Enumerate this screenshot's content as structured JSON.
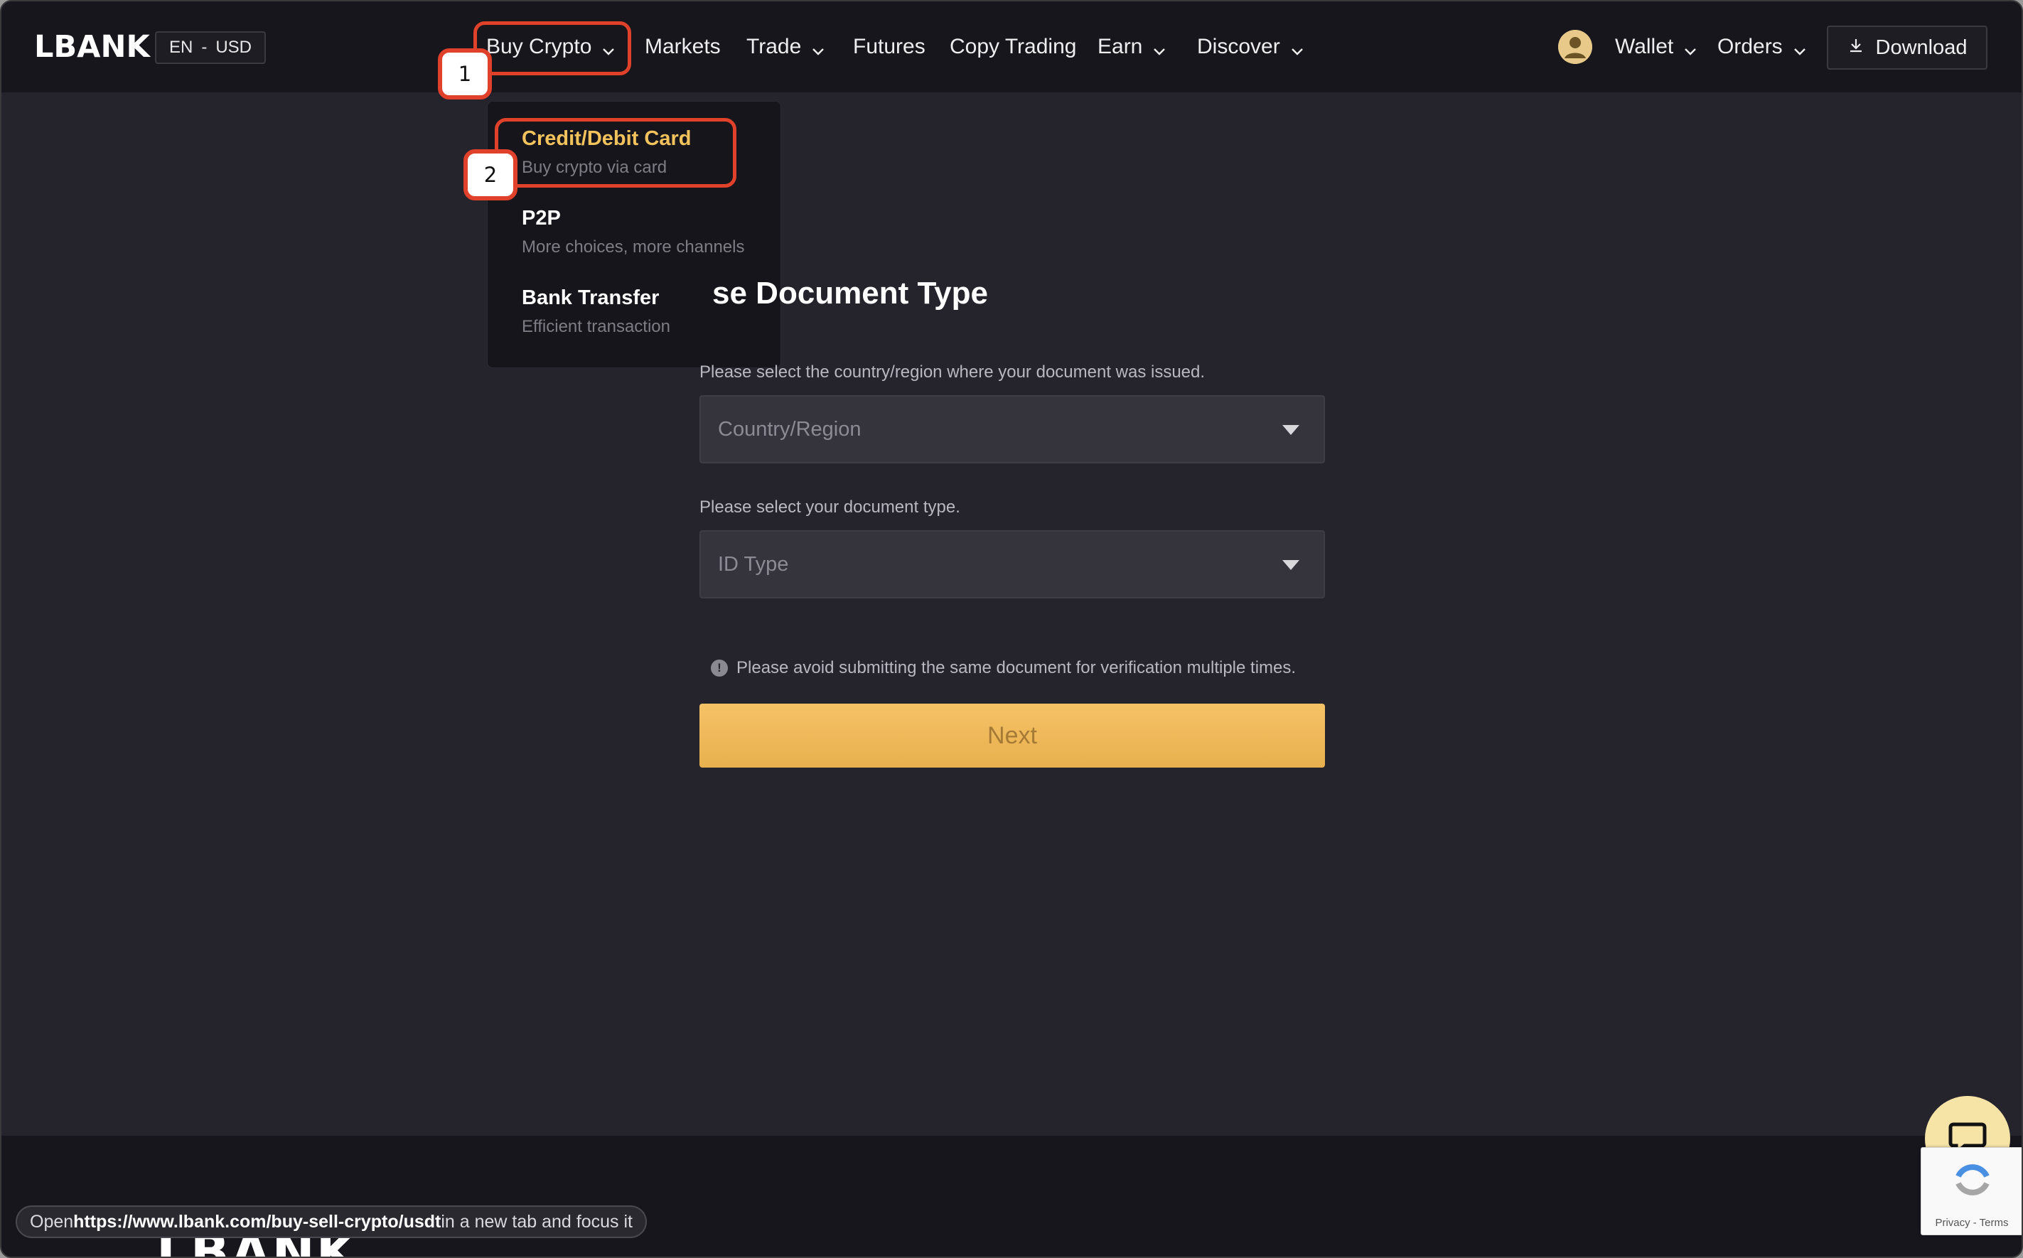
{
  "header": {
    "logo": "LBANK",
    "lang_currency": {
      "lang": "EN",
      "sep": "-",
      "currency": "USD"
    },
    "nav": {
      "buy_crypto": "Buy Crypto",
      "markets": "Markets",
      "trade": "Trade",
      "futures": "Futures",
      "copy_trading": "Copy Trading",
      "earn": "Earn",
      "discover": "Discover"
    },
    "wallet": "Wallet",
    "orders": "Orders",
    "download": "Download"
  },
  "annotations": {
    "step1": "1",
    "step2": "2"
  },
  "dropdown": {
    "items": [
      {
        "title": "Credit/Debit Card",
        "subtitle": "Buy crypto via card"
      },
      {
        "title": "P2P",
        "subtitle": "More choices, more channels"
      },
      {
        "title": "Bank Transfer",
        "subtitle": "Efficient transaction"
      }
    ]
  },
  "form": {
    "title": "se Document Type",
    "country_label": "Please select the country/region where your document was issued.",
    "country_placeholder": "Country/Region",
    "doc_label": "Please select your document type.",
    "doc_placeholder": "ID Type",
    "notice": "Please avoid submitting the same document for verification multiple times.",
    "next": "Next"
  },
  "status_bar": {
    "prefix": "Open ",
    "url": "https://www.lbank.com/buy-sell-crypto/usdt",
    "suffix": " in a new tab and focus it"
  },
  "footer": {
    "logo": "LBANK"
  },
  "recaptcha": {
    "terms": "Privacy - Terms"
  },
  "colors": {
    "accent": "#f2c35d",
    "highlight": "#e0412b",
    "bg": "#25242d",
    "header_bg": "#17161d"
  }
}
